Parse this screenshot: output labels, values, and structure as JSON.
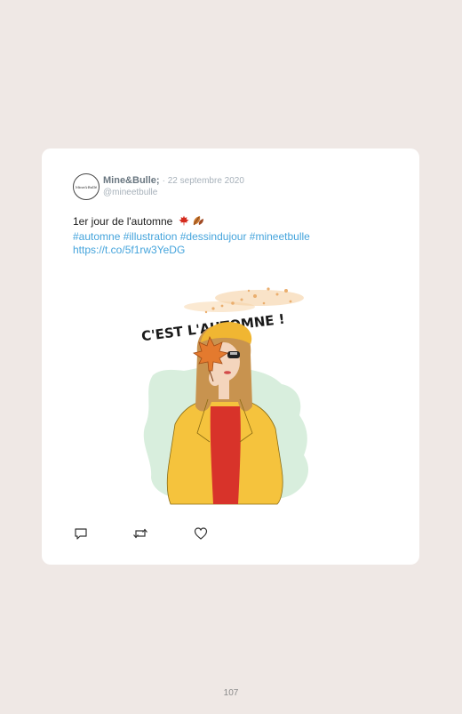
{
  "tweet": {
    "avatar_text": "Mine&Bullé",
    "display_name": "Mine&Bulle;",
    "date": "· 22 septembre 2020",
    "handle": "@mineetbulle",
    "text": "1er jour de l'automne",
    "hashtags": "#automne #illustration #dessindujour #mineetbulle",
    "link": "https://t.co/5f1rw3YeDG",
    "emoji_icons": [
      "maple-leaf-icon",
      "fallen-leaf-icon"
    ],
    "image_caption": "C'EST L'AUTOMNE !",
    "actions": [
      "reply-icon",
      "retweet-icon",
      "like-icon"
    ]
  },
  "colors": {
    "background": "#efe8e5",
    "card": "#ffffff",
    "link": "#45a4dc",
    "muted": "#a7b1ba",
    "name": "#6a7781"
  },
  "page": {
    "number": "107"
  }
}
